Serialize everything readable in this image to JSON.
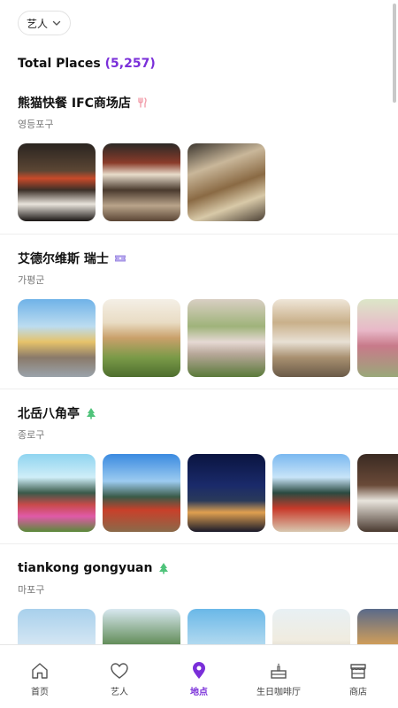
{
  "filter": {
    "label": "艺人"
  },
  "summary": {
    "label": "Total Places",
    "count": "(5,257)"
  },
  "places": [
    {
      "name": "熊猫快餐 IFC商场店",
      "district": "영등포구",
      "icon": "restaurant-icon"
    },
    {
      "name": "艾德尔维斯 瑞士",
      "district": "가평군",
      "icon": "ticket-icon"
    },
    {
      "name": "北岳八角亭",
      "district": "종로구",
      "icon": "tree-icon"
    },
    {
      "name": "tiankong gongyuan",
      "district": "마포구",
      "icon": "tree-icon"
    }
  ],
  "tabs": [
    {
      "label": "首页",
      "icon": "home-icon"
    },
    {
      "label": "艺人",
      "icon": "heart-icon"
    },
    {
      "label": "地点",
      "icon": "location-pin-icon",
      "active": true
    },
    {
      "label": "生日咖啡厅",
      "icon": "cake-icon"
    },
    {
      "label": "商店",
      "icon": "store-icon"
    }
  ],
  "colors": {
    "accent": "#7a2fd9",
    "restaurant_icon": "#f19aa8",
    "ticket_icon": "#9c8ae0",
    "tree_icon": "#4fc37a"
  }
}
